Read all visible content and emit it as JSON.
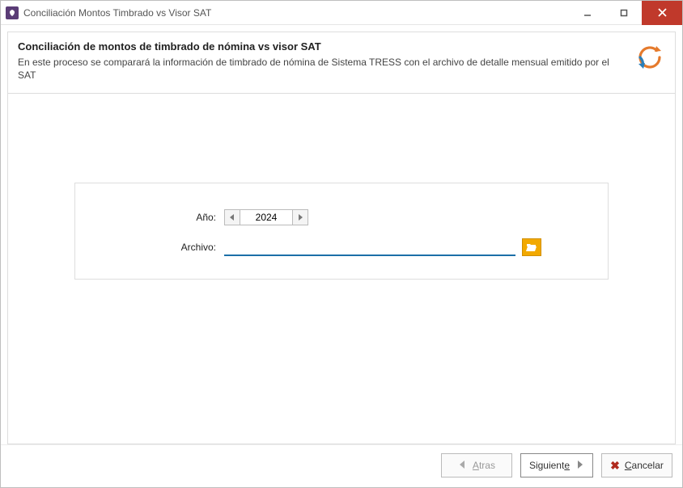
{
  "window": {
    "title": "Conciliación Montos Timbrado vs Visor SAT"
  },
  "header": {
    "title": "Conciliación de montos de timbrado de nómina vs visor SAT",
    "description": "En este proceso se comparará la información de timbrado de nómina de Sistema TRESS con el archivo de detalle mensual emitido por el SAT"
  },
  "form": {
    "year_label": "Año:",
    "year_value": "2024",
    "file_label": "Archivo:",
    "file_value": ""
  },
  "footer": {
    "back_prefix": "A",
    "back_rest": "tras",
    "next_prefix": "Siguient",
    "next_underline": "e",
    "cancel_underline": "C",
    "cancel_rest": "ancelar"
  }
}
